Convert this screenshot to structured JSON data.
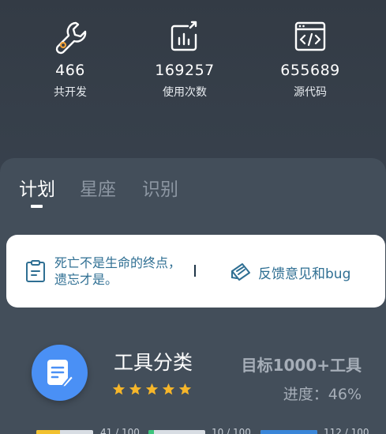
{
  "stats": [
    {
      "value": "466",
      "label": "共开发",
      "icon": "wrench-icon"
    },
    {
      "value": "169257",
      "label": "使用次数",
      "icon": "chart-icon"
    },
    {
      "value": "655689",
      "label": "源代码",
      "icon": "code-icon"
    }
  ],
  "tabs": [
    {
      "label": "计划",
      "active": true
    },
    {
      "label": "星座",
      "active": false
    },
    {
      "label": "识别",
      "active": false
    }
  ],
  "notice": {
    "quote": "死亡不是生命的终点，遗忘才是。",
    "feedback_label": "反馈意见和bug"
  },
  "category": {
    "title": "工具分类",
    "rating": 5,
    "target": "目标1000+工具",
    "progress_text": "进度：46%",
    "progress": 0.46
  },
  "bars": [
    {
      "text": "41 / 100",
      "value": 41,
      "max": 100,
      "color": "#f2c12e"
    },
    {
      "text": "10 / 100",
      "value": 10,
      "max": 100,
      "color": "#3cc47c"
    },
    {
      "text": "112 / 100",
      "value": 112,
      "max": 100,
      "color": "#3a86d8"
    }
  ],
  "colors": {
    "accent_blue": "#4a90f5",
    "star": "#f6b62a",
    "notice_text": "#2f6f93"
  }
}
